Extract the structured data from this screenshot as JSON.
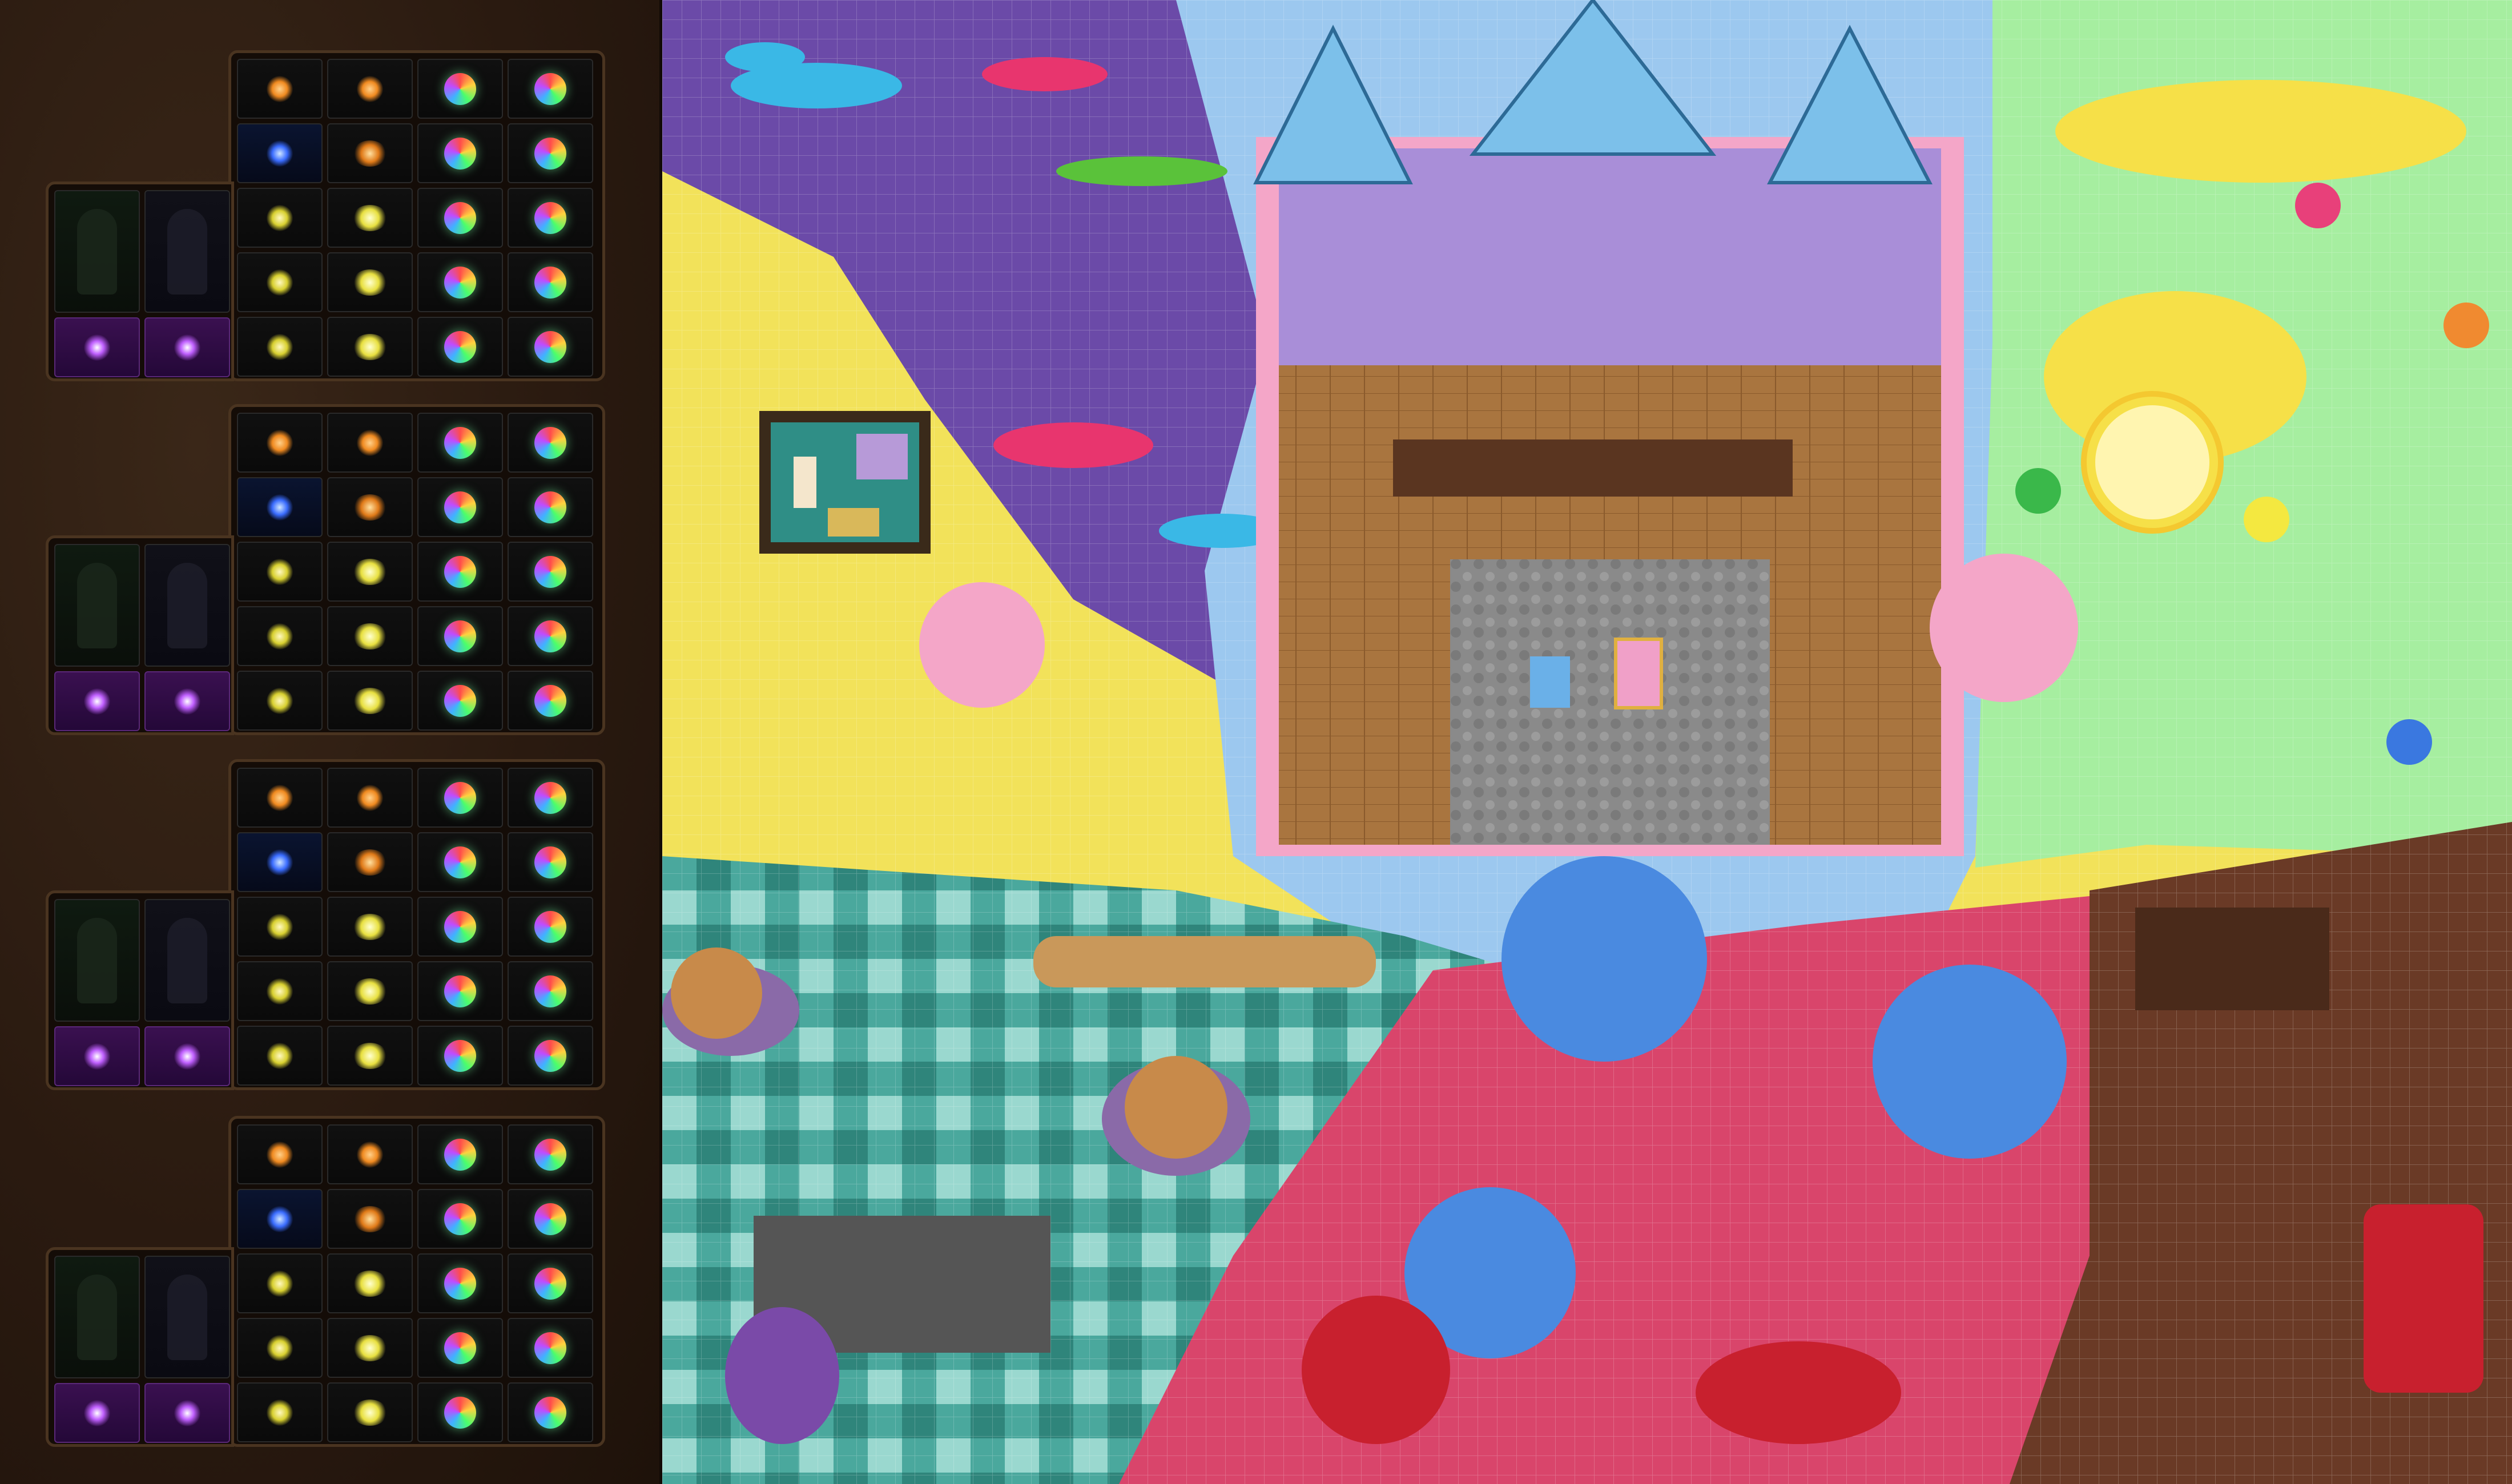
{
  "hud": {
    "hotbar_count": 4,
    "main_rows": [
      [
        "orange-gem-icon",
        "orange-gem-icon",
        "rainbow-gem-icon",
        "rainbow-gem-icon"
      ],
      [
        "blue-gem-icon",
        "double-orange-gem-icon",
        "rainbow-gem-icon",
        "rainbow-gem-icon"
      ],
      [
        "yellow-gem-icon",
        "double-yellow-gem-icon",
        "rainbow-gem-icon",
        "rainbow-gem-icon"
      ],
      [
        "yellow-gem-icon",
        "double-yellow-gem-icon",
        "rainbow-gem-icon",
        "rainbow-gem-icon"
      ],
      [
        "yellow-gem-icon",
        "double-yellow-gem-icon",
        "rainbow-gem-icon",
        "rainbow-gem-icon"
      ]
    ],
    "side_slots": [
      "character-portrait-slot",
      "character-portrait-slot",
      "violet-eye-icon",
      "violet-eye-icon"
    ]
  },
  "map": {
    "regions": [
      "purple-field",
      "yellow-field",
      "blue-field",
      "green-field",
      "teal-checker-field",
      "pink-field",
      "chocolate-field"
    ],
    "colors": {
      "purple": "#6b4aa8",
      "yellow": "#f2e25a",
      "sky": "#9cc8ef",
      "mint": "#a6eea0",
      "teal": "#3f9e94",
      "raspberry": "#d9456b",
      "cocoa": "#6a3a26",
      "castle_wall": "#f4a6c8",
      "castle_roof": "#7cc0ea",
      "floor": "#a8753f"
    }
  }
}
